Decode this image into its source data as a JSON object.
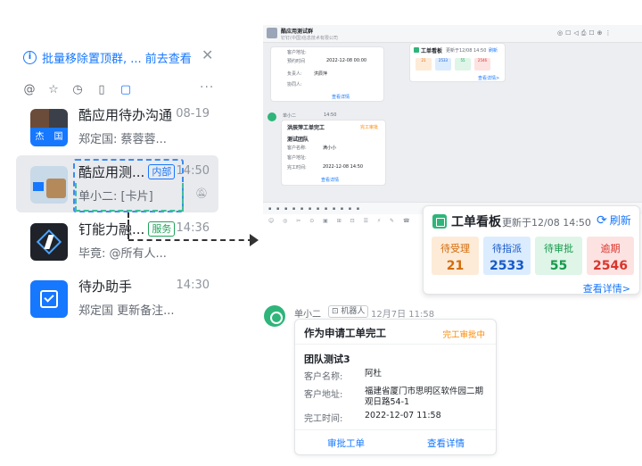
{
  "banner": {
    "text": "批量移除置顶群, ... 前去查看",
    "info_icon": "i",
    "close_icon": "✕"
  },
  "filters": [
    "@",
    "☆",
    "◷",
    "▯",
    "▢"
  ],
  "filters_more": "···",
  "chats": [
    {
      "name": "酷应用待办沟通",
      "time": "08-19",
      "preview": "郑定国: 蔡蓉蓉...",
      "tag": ""
    },
    {
      "name": "酷应用测...",
      "time": "14:50",
      "preview": "单小二: [卡片]",
      "tag": "内部"
    },
    {
      "name": "钉能力融...",
      "time": "14:36",
      "preview": "毕竟: @所有人...",
      "tag": "服务"
    },
    {
      "name": "待办助手",
      "time": "14:30",
      "preview": "郑定国 更新备注...",
      "tag": ""
    }
  ],
  "avatar_chars": [
    "杰",
    "国"
  ],
  "mini": {
    "title": "酷应用测试群",
    "subtitle": "钉钉(中国)信息技术有限公司",
    "fields_top": [
      "客户地址:",
      "预约时间",
      "2022-12-08 00:00",
      "负责人:",
      "洪辰萍",
      "协同人:"
    ],
    "link_top": "查看详情",
    "sender": "单小二",
    "time": "14:50",
    "card_title": "洪辰萍工单完工",
    "card_status": "完工审批",
    "team": "测试团队",
    "fields": [
      "客户名称:",
      "客户地址:",
      "完工时间:"
    ],
    "values": [
      "满小小",
      "",
      "2022-12-08 14:50"
    ],
    "link": "查看详情",
    "board_title": "工单看板",
    "board_update": "更新于12/08 14:50",
    "board_refresh": "刷新",
    "board_details": "查看详情>",
    "stats": [
      "21",
      "2533",
      "55",
      "2546"
    ]
  },
  "board": {
    "title": "工单看板",
    "updated": "更新于12/08 14:50",
    "refresh": "刷新",
    "stats": [
      {
        "label": "待受理",
        "value": "21",
        "bg": "#fdebd8",
        "color": "#d46b08"
      },
      {
        "label": "待指派",
        "value": "2533",
        "bg": "#dcecff",
        "color": "#1659c7"
      },
      {
        "label": "待审批",
        "value": "55",
        "bg": "#dff5e8",
        "color": "#159a4c"
      },
      {
        "label": "逾期",
        "value": "2546",
        "bg": "#fde2e2",
        "color": "#d9352b"
      }
    ],
    "details": "查看详情>"
  },
  "message": {
    "sender": "单小二",
    "badge": "机器人",
    "time": "12月7日 11:58",
    "title": "作为申请工单完工",
    "status": "完工审批中",
    "team": "团队测试3",
    "fields": [
      {
        "label": "客户名称:",
        "value": "阿杜"
      },
      {
        "label": "客户地址:",
        "value": "福建省厦门市思明区软件园二期观日路54-1"
      },
      {
        "label": "完工时间:",
        "value": "2022-12-07 11:58"
      }
    ],
    "approve": "审批工单",
    "details": "查看详情"
  }
}
